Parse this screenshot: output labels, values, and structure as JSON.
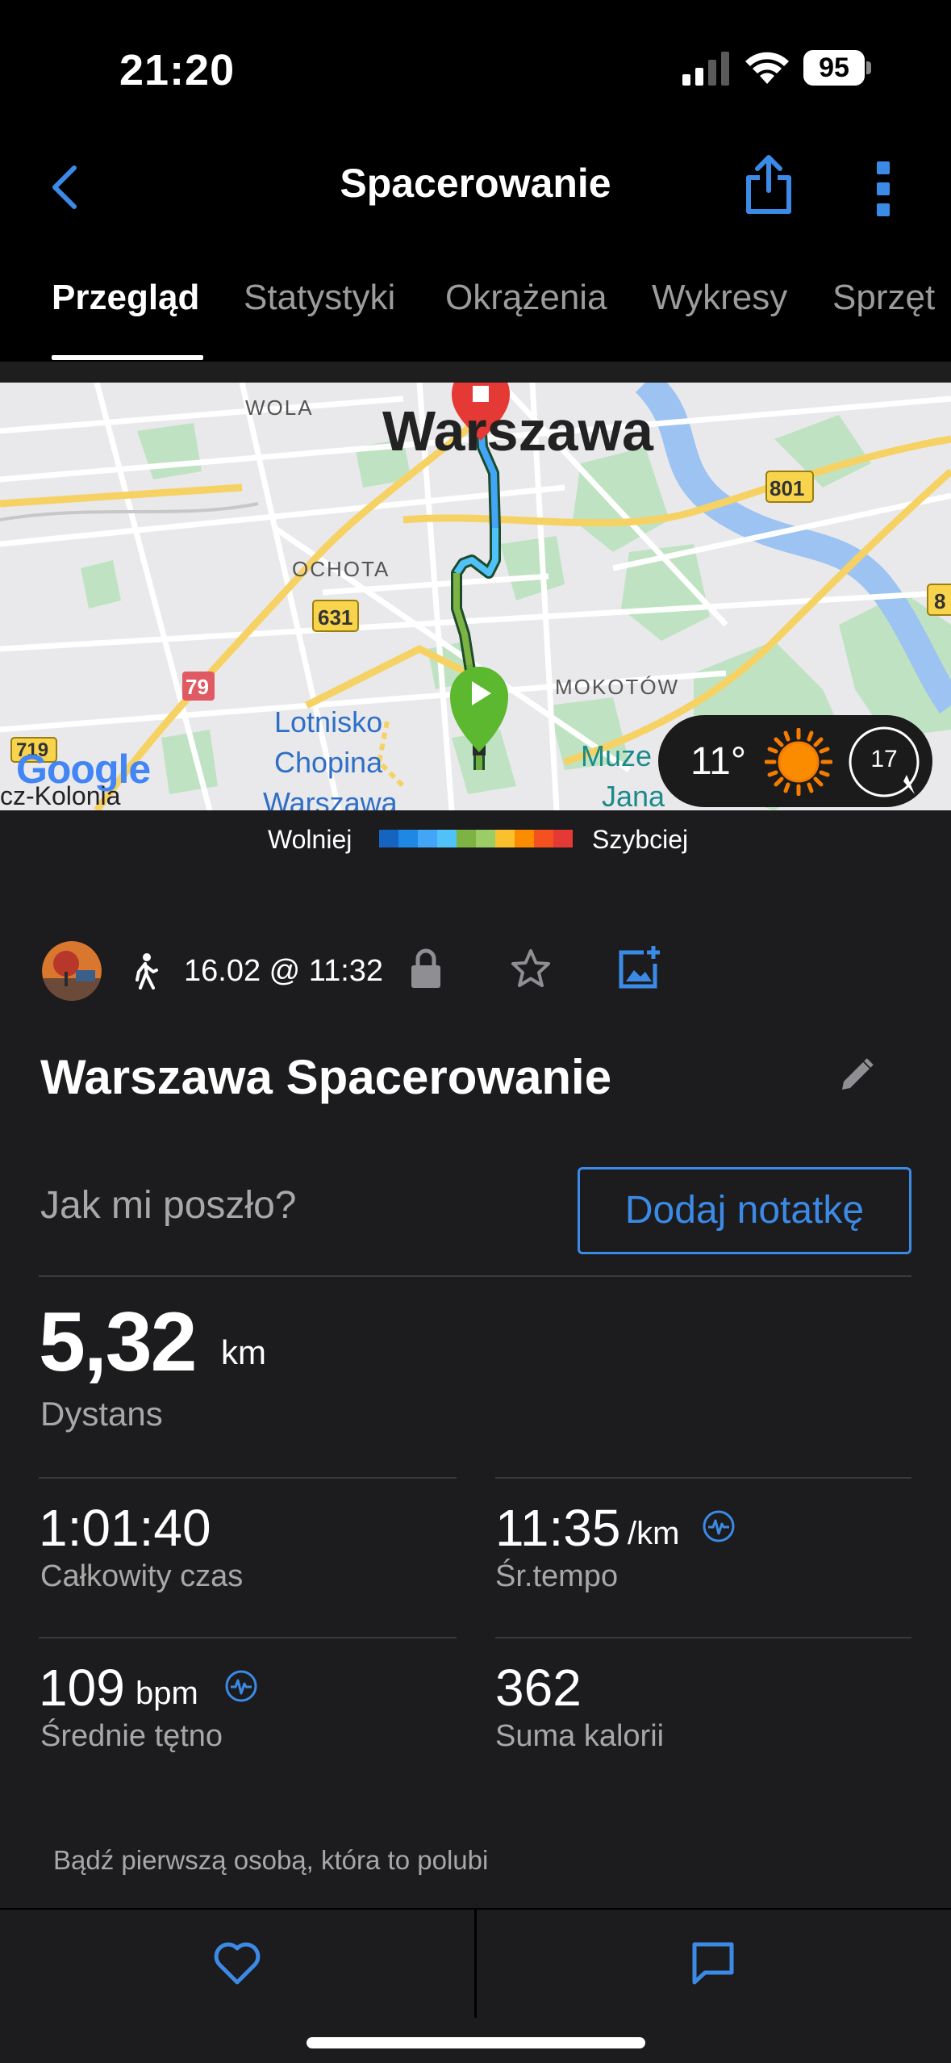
{
  "status_bar": {
    "time": "21:20",
    "battery": "95"
  },
  "nav": {
    "title": "Spacerowanie"
  },
  "tabs": [
    {
      "label": "Przegląd",
      "active": true
    },
    {
      "label": "Statystyki",
      "active": false
    },
    {
      "label": "Okrążenia",
      "active": false
    },
    {
      "label": "Wykresy",
      "active": false
    },
    {
      "label": "Sprzęt",
      "active": false
    }
  ],
  "map": {
    "labels": {
      "city": "Warszawa",
      "wola": "WOLA",
      "ochota": "OCHOTA",
      "mokotow": "MOKOTÓW",
      "airport_1": "Lotnisko",
      "airport_2": "Chopina",
      "airport_3": "Warszawa",
      "museum_1": "Muze",
      "museum_2": "Jana",
      "kolonia": "cz-Kolonia",
      "google": "Google",
      "road_801": "801",
      "road_631": "631",
      "road_79": "79",
      "road_719": "719",
      "road_8": "8"
    },
    "weather": {
      "temperature": "11°",
      "wind": "17",
      "condition_icon": "sun-icon"
    }
  },
  "legend": {
    "slow_label": "Wolniej",
    "fast_label": "Szybciej",
    "colors": [
      "#1565c0",
      "#1e88e5",
      "#42a5f5",
      "#4fc3f7",
      "#7cb342",
      "#9ccc65",
      "#fbc02d",
      "#fb8c00",
      "#f4511e",
      "#e53935"
    ]
  },
  "activity": {
    "date": "16.02 @ 11:32",
    "title": "Warszawa Spacerowanie",
    "how_prompt": "Jak mi poszło?",
    "add_note_label": "Dodaj notatkę",
    "distance": {
      "value": "5,32",
      "unit": "km",
      "label": "Dystans"
    },
    "stats": {
      "total_time": {
        "value": "1:01:40",
        "label": "Całkowity czas"
      },
      "avg_pace": {
        "value": "11:35",
        "unit": "/km",
        "label": "Śr.tempo"
      },
      "avg_hr": {
        "value": "109",
        "unit": "bpm",
        "label": "Średnie tętno"
      },
      "calories": {
        "value": "362",
        "label": "Suma kalorii"
      }
    },
    "likes_text": "Bądź pierwszą osobą, która to polubi"
  },
  "colors": {
    "accent": "#3b8ae6",
    "background": "#1c1c1e",
    "start_marker": "#5cb82f",
    "end_marker": "#e53935"
  }
}
